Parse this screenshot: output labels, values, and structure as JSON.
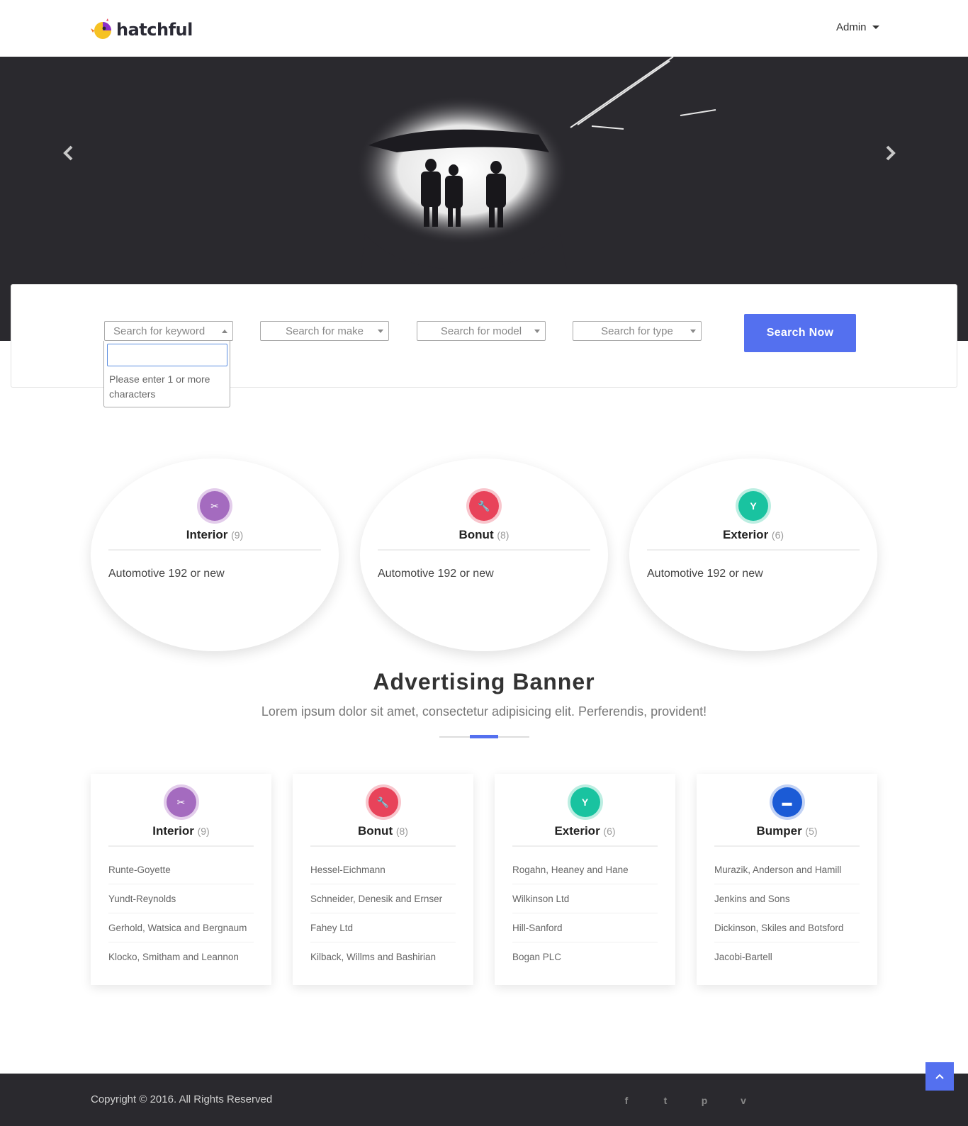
{
  "header": {
    "brand": "hatchful",
    "admin_label": "Admin"
  },
  "carousel": {
    "prev_icon": "chevron-left-icon",
    "next_icon": "chevron-right-icon"
  },
  "search": {
    "keyword_placeholder": "Search for keyword",
    "make_placeholder": "Search for make",
    "model_placeholder": "Search for model",
    "type_placeholder": "Search for type",
    "button_label": "Search Now",
    "dropdown_message": "Please enter 1 or more characters"
  },
  "featured": [
    {
      "title": "Interior",
      "count": "(9)",
      "desc": "Automotive 192 or new",
      "icon": "scissors-icon",
      "color": "#a46bbf"
    },
    {
      "title": "Bonut",
      "count": "(8)",
      "desc": "Automotive 192 or new",
      "icon": "wrench-icon",
      "color": "#e8435a"
    },
    {
      "title": "Exterior",
      "count": "(6)",
      "desc": "Automotive 192 or new",
      "icon": "cocktail-icon",
      "color": "#19c3a0"
    }
  ],
  "banner": {
    "title": "Advertising Banner",
    "subtitle": "Lorem ipsum dolor sit amet, consectetur adipisicing elit. Perferendis, provident!"
  },
  "categories": [
    {
      "title": "Interior",
      "count": "(9)",
      "icon": "scissors-icon",
      "color": "#a46bbf",
      "items": [
        "Runte-Goyette",
        "Yundt-Reynolds",
        "Gerhold, Watsica and Bergnaum",
        "Klocko, Smitham and Leannon"
      ]
    },
    {
      "title": "Bonut",
      "count": "(8)",
      "icon": "wrench-icon",
      "color": "#e8435a",
      "items": [
        "Hessel-Eichmann",
        "Schneider, Denesik and Ernser",
        "Fahey Ltd",
        "Kilback, Willms and Bashirian"
      ]
    },
    {
      "title": "Exterior",
      "count": "(6)",
      "icon": "cocktail-icon",
      "color": "#19c3a0",
      "items": [
        "Rogahn, Heaney and Hane",
        "Wilkinson Ltd",
        "Hill-Sanford",
        "Bogan PLC"
      ]
    },
    {
      "title": "Bumper",
      "count": "(5)",
      "icon": "bed-icon",
      "color": "#1b5bd6",
      "items": [
        "Murazik, Anderson and Hamill",
        "Jenkins and Sons",
        "Dickinson, Skiles and Botsford",
        "Jacobi-Bartell"
      ]
    }
  ],
  "footer": {
    "copyright": "Copyright © 2016. All Rights Reserved",
    "social": [
      "facebook-icon",
      "twitter-icon",
      "pinterest-icon",
      "vimeo-icon"
    ]
  },
  "colors": {
    "accent": "#5470ef",
    "dark": "#2a292e"
  }
}
